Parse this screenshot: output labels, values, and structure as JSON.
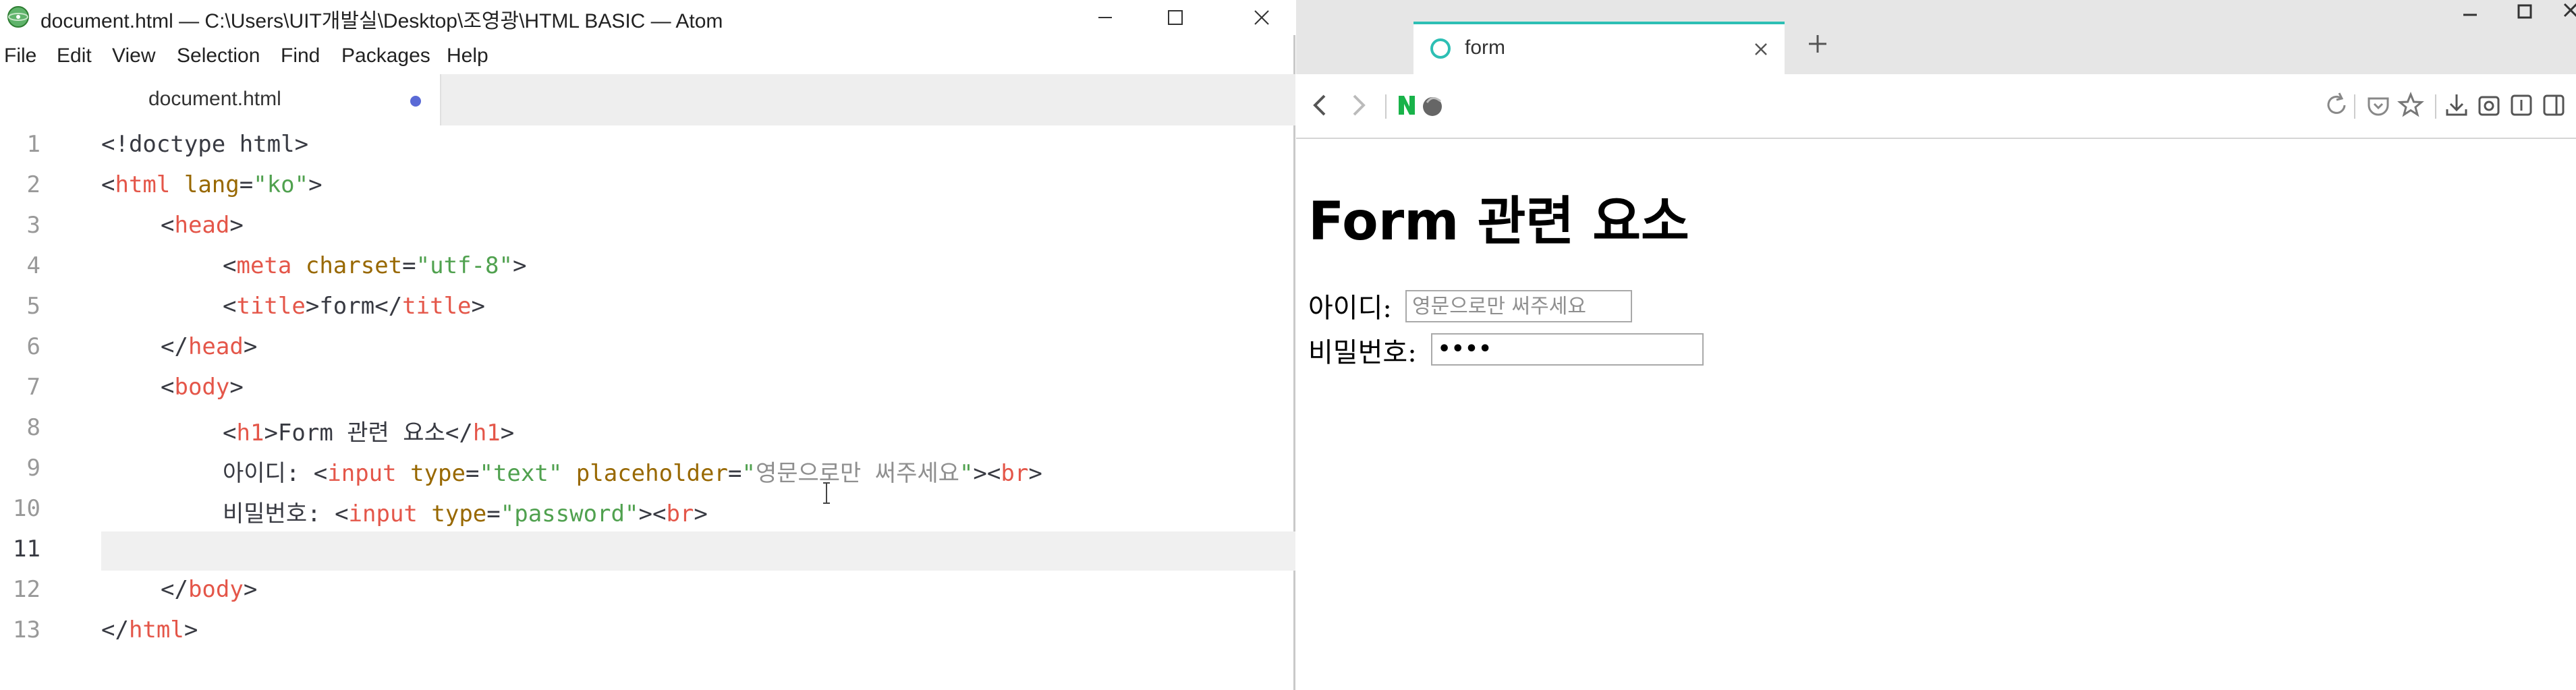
{
  "atom": {
    "title": "document.html — C:\\Users\\UIT개발실\\Desktop\\조영광\\HTML BASIC — Atom",
    "menu": [
      "File",
      "Edit",
      "View",
      "Selection",
      "Find",
      "Packages",
      "Help"
    ],
    "tab_label": "document.html",
    "line_numbers": [
      "1",
      "2",
      "3",
      "4",
      "5",
      "6",
      "7",
      "8",
      "9",
      "10",
      "11",
      "12",
      "13"
    ],
    "code": {
      "l1": "<!doctype html>",
      "l2": {
        "a": "<",
        "tag": "html",
        "sp": " ",
        "attr": "lang",
        "eq": "=",
        "str": "\"ko\"",
        "b": ">"
      },
      "l3": {
        "a": "<",
        "tag": "head",
        "b": ">"
      },
      "l4": {
        "a": "<",
        "tag": "meta",
        "sp": " ",
        "attr": "charset",
        "eq": "=",
        "str": "\"utf-8\"",
        "b": ">"
      },
      "l5": {
        "a": "<",
        "tag": "title",
        "b": ">",
        "txt": "form",
        "c": "</",
        "tag2": "title",
        "d": ">"
      },
      "l6": {
        "a": "</",
        "tag": "head",
        "b": ">"
      },
      "l7": {
        "a": "<",
        "tag": "body",
        "b": ">"
      },
      "l8": {
        "a": "<",
        "tag": "h1",
        "b": ">",
        "txt": "Form 관련 요소",
        "c": "</",
        "tag2": "h1",
        "d": ">"
      },
      "l9": {
        "txt": "아이디: ",
        "a": "<",
        "tag": "input",
        "sp": " ",
        "attr": "type",
        "eq": "=",
        "str": "\"text\"",
        "sp2": " ",
        "attr2": "placeholder",
        "eq2": "=",
        "q1": "\"",
        "ph": "영문으로만 써주세요",
        "q2": "\"",
        "b": ">",
        "c": "<",
        "tag2": "br",
        "d": ">"
      },
      "l10": {
        "txt": "비밀번호: ",
        "a": "<",
        "tag": "input",
        "sp": " ",
        "attr": "type",
        "eq": "=",
        "str": "\"password\"",
        "b": ">",
        "c": "<",
        "tag2": "br",
        "d": ">"
      },
      "l12": {
        "a": "</",
        "tag": "body",
        "b": ">"
      },
      "l13": {
        "a": "</",
        "tag": "html",
        "b": ">"
      }
    }
  },
  "browser": {
    "tab_title": "form",
    "page": {
      "heading": "Form 관련 요소",
      "id_label": "아이디:",
      "id_placeholder": "영문으로만 써주세요",
      "pw_label": "비밀번호:",
      "pw_value": "••••"
    }
  }
}
